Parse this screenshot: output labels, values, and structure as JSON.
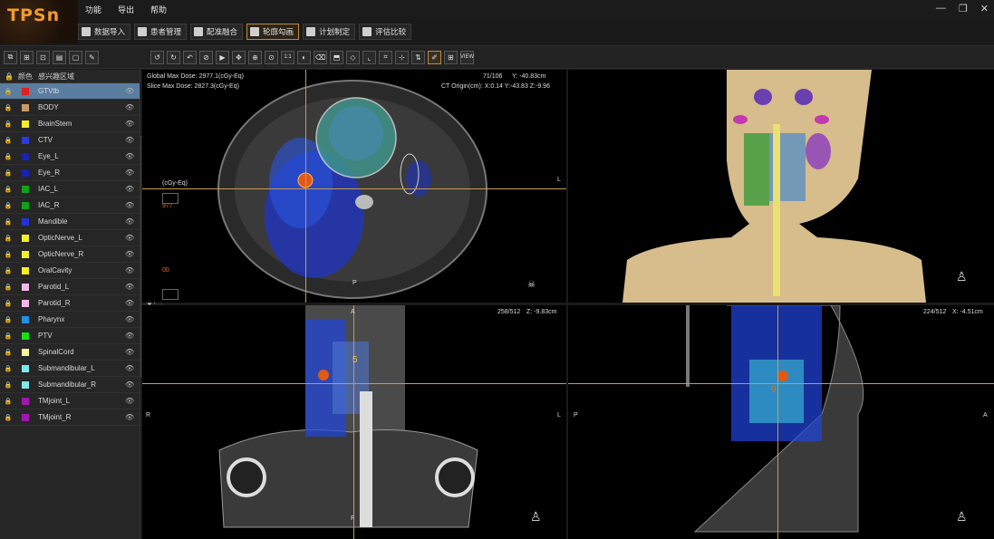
{
  "app": {
    "logo": "TPSn"
  },
  "menu": {
    "items": [
      "功能",
      "导出",
      "帮助"
    ]
  },
  "window": {
    "minimize": "—",
    "restore": "❐",
    "close": "✕"
  },
  "toolbar": {
    "buttons": [
      {
        "label": "数据导入",
        "icon": "import-icon"
      },
      {
        "label": "患者管理",
        "icon": "patient-icon"
      },
      {
        "label": "配准融合",
        "icon": "fusion-icon"
      },
      {
        "label": "轮廓勾画",
        "icon": "contour-icon",
        "active": true
      },
      {
        "label": "计划制定",
        "icon": "plan-icon"
      },
      {
        "label": "评估比较",
        "icon": "evaluate-icon"
      }
    ]
  },
  "tools": {
    "left": [
      "⧉",
      "⊞",
      "⊡",
      "▤",
      "▢",
      "✎"
    ],
    "right": [
      "↺",
      "↻",
      "↶",
      "⊘",
      "▶",
      "✥",
      "⊕",
      "⊙",
      "1:1",
      "◐",
      "⌫",
      "⬒",
      "◇",
      "⌞",
      "⌗",
      "⊹",
      "⇅",
      "✐",
      "⊞",
      "VIEW"
    ]
  },
  "structures": {
    "header": {
      "color": "颜色",
      "name": "感兴趣区域"
    },
    "items": [
      {
        "name": "GTVtb",
        "color": "#e0201e",
        "selected": true
      },
      {
        "name": "BODY",
        "color": "#c8996a"
      },
      {
        "name": "BrainStem",
        "color": "#f4ee2a"
      },
      {
        "name": "CTV",
        "color": "#2a3ae0"
      },
      {
        "name": "Eye_L",
        "color": "#1a22b0"
      },
      {
        "name": "Eye_R",
        "color": "#1a22b0"
      },
      {
        "name": "IAC_L",
        "color": "#13a01a"
      },
      {
        "name": "IAC_R",
        "color": "#13a01a"
      },
      {
        "name": "Mandible",
        "color": "#2234d8"
      },
      {
        "name": "OpticNerve_L",
        "color": "#f4ee2a"
      },
      {
        "name": "OpticNerve_R",
        "color": "#f4ee2a"
      },
      {
        "name": "OralCavity",
        "color": "#f4ee2a"
      },
      {
        "name": "Parotid_L",
        "color": "#f2b8e8"
      },
      {
        "name": "Parotid_R",
        "color": "#f2b8e8"
      },
      {
        "name": "Pharynx",
        "color": "#2090e0"
      },
      {
        "name": "PTV",
        "color": "#18e018"
      },
      {
        "name": "SpinalCord",
        "color": "#f4f49a"
      },
      {
        "name": "Submandibular_L",
        "color": "#7ee8ec"
      },
      {
        "name": "Submandibular_R",
        "color": "#7ee8ec"
      },
      {
        "name": "TMjoint_L",
        "color": "#a018b0"
      },
      {
        "name": "TMjoint_R",
        "color": "#a018b0"
      }
    ]
  },
  "drawtools": [
    "✎",
    "✐",
    "⊕",
    "≡",
    "⌇",
    "▭",
    "◯",
    "⌫",
    "⊡",
    "↶",
    "↷",
    "⬒",
    "⊗"
  ],
  "views": {
    "axial": {
      "global_max": "Global Max Dose: 2977.1(cGy-Eq)",
      "slice_max": "Slice Max Dose: 2827.3(cGy-Eq)",
      "slice": "71/106",
      "y": "Y: -40.83cm",
      "origin": "CT Origin(cm): X:0.14  Y:-43.83  Z:-9.96",
      "l": "L",
      "p": "P",
      "unit": "(cGy-Eq)",
      "val1": "977",
      "val2": "00"
    },
    "coronal": {
      "slice": "258/512",
      "z": "Z: -9.83cm",
      "r": "R",
      "l": "L",
      "a": "A",
      "f": "F",
      "mark": "5"
    },
    "sagittal": {
      "slice": "224/512",
      "x": "X: -4.51cm",
      "p": "P",
      "a": "A",
      "mark": "9"
    }
  }
}
